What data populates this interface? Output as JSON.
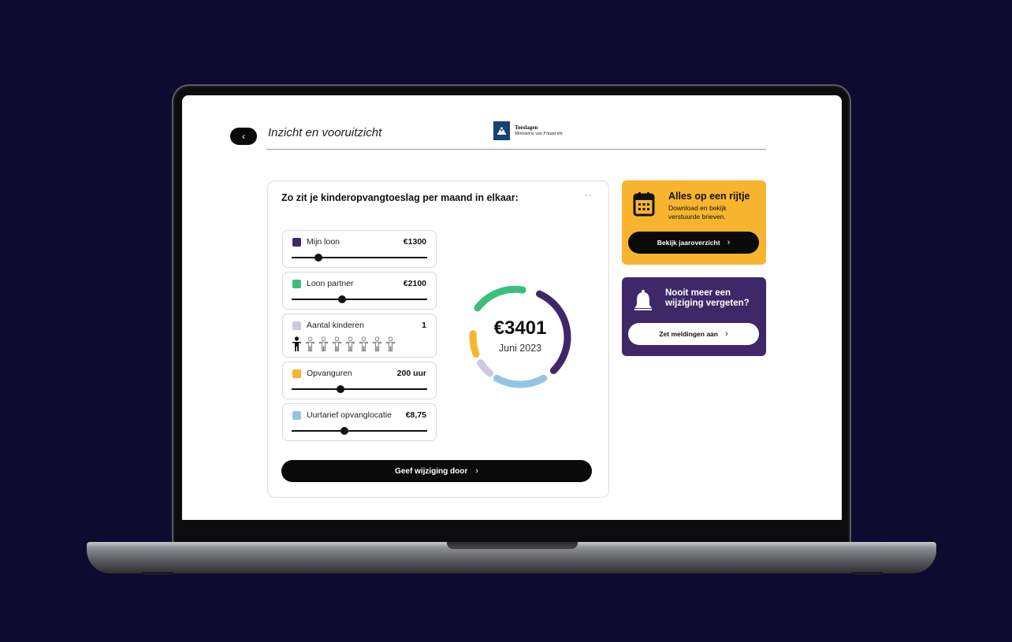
{
  "header": {
    "back_icon": "chevron-left-icon",
    "title": "Inzicht en vooruitzicht",
    "logo": {
      "name": "Toeslagen",
      "subtitle": "Ministerie van Financiën"
    }
  },
  "calculator": {
    "heading": "Zo zit je kinderopvangtoeslag per maand in elkaar:",
    "more": "··",
    "items": [
      {
        "label": "Mijn loon",
        "value": "€1300",
        "color": "#3e2868",
        "slider_fraction": 0.2
      },
      {
        "label": "Loon partner",
        "value": "€2100",
        "color": "#3bbf7b",
        "slider_fraction": 0.37
      },
      {
        "label": "Aantal kinderen",
        "value": "1",
        "color": "#cfc7e3",
        "children_total": 8,
        "children_selected": 1
      },
      {
        "label": "Opvanguren",
        "value": "200 uur",
        "color": "#f7b52f",
        "slider_fraction": 0.36
      },
      {
        "label": "Uurtarief opvanglocatie",
        "value": "€8,75",
        "color": "#93c4e3",
        "slider_fraction": 0.39
      }
    ],
    "total": {
      "amount": "€3401",
      "period": "Juni 2023"
    },
    "submit_label": "Geef wijziging door"
  },
  "overview_card": {
    "icon": "calendar-icon",
    "title": "Alles op een rijtje",
    "description": "Download en bekijk verstuurde brieven.",
    "button_label": "Bekijk jaaroverzicht"
  },
  "notify_card": {
    "icon": "bell-icon",
    "title": "Nooit meer een wijziging vergeten?",
    "button_label": "Zet meldingen aan"
  },
  "colors": {
    "background": "#0e0a30",
    "purple": "#3e2868",
    "green": "#3bbf7b",
    "lavender": "#cfc7e3",
    "yellow": "#f7b52f",
    "light_blue": "#93c4e3"
  }
}
